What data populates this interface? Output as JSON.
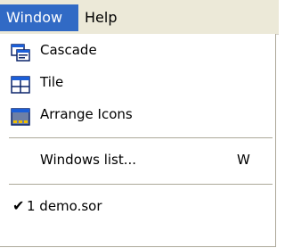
{
  "menubar": {
    "items": [
      {
        "label": "Window",
        "active": true
      },
      {
        "label": "Help",
        "active": false
      }
    ]
  },
  "window_menu": {
    "items": [
      {
        "label": "Cascade",
        "icon": "cascade-windows-icon"
      },
      {
        "label": "Tile",
        "icon": "tile-windows-icon"
      },
      {
        "label": "Arrange Icons",
        "icon": "arrange-icons-icon"
      }
    ],
    "windows_list": {
      "label": "Windows list...",
      "shortcut": "W"
    },
    "open_windows": [
      {
        "label": "1 demo.sor",
        "checked": true,
        "check_glyph": "✔"
      }
    ]
  },
  "colors": {
    "menu_highlight": "#316ac5",
    "menubar_bg": "#ece9d8",
    "icon_blue": "#0a246a",
    "icon_titlebar": "#1c5fd8"
  }
}
